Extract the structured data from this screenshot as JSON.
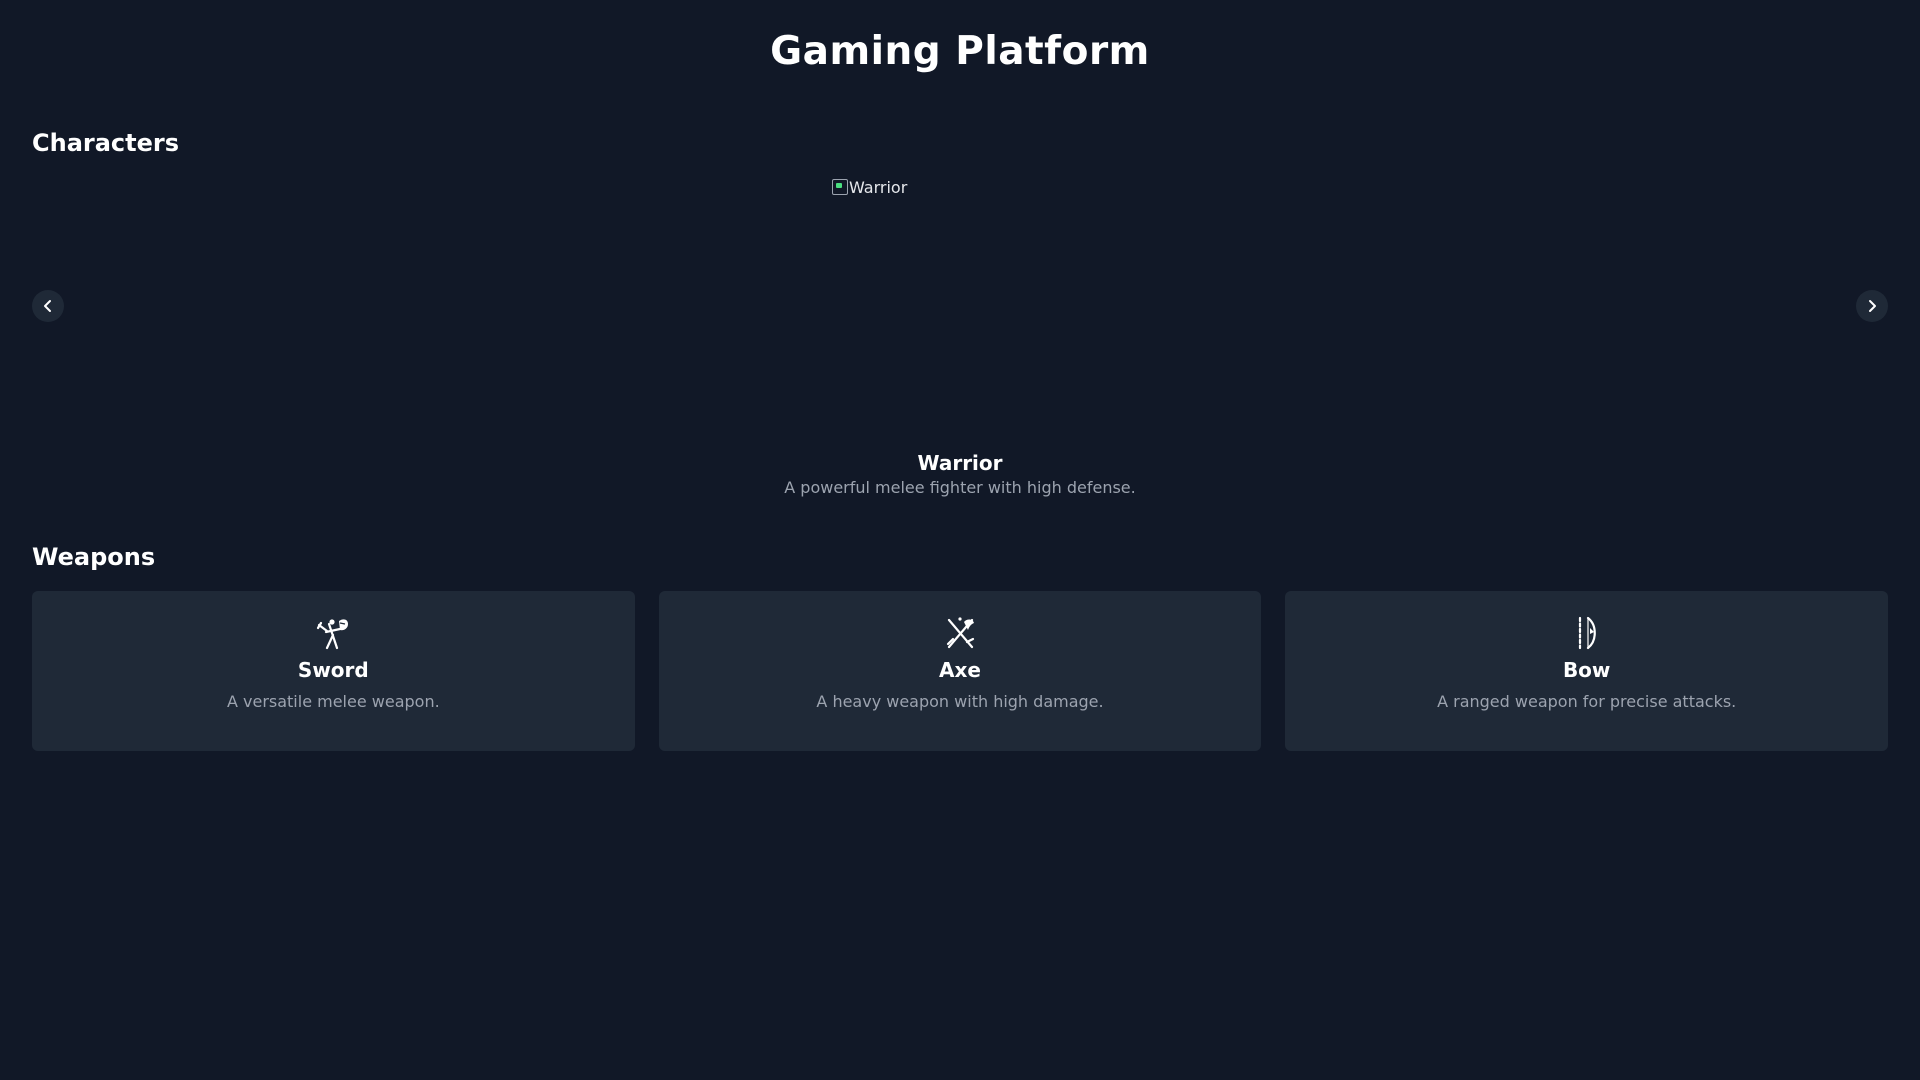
{
  "page": {
    "title": "Gaming Platform"
  },
  "characters": {
    "heading": "Characters",
    "current": {
      "image_alt": "Warrior",
      "name": "Warrior",
      "description": "A powerful melee fighter with high defense."
    },
    "prev_icon": "chevron-left-icon",
    "next_icon": "chevron-right-icon"
  },
  "weapons": {
    "heading": "Weapons",
    "items": [
      {
        "icon": "sword-icon",
        "name": "Sword",
        "description": "A versatile melee weapon."
      },
      {
        "icon": "axe-icon",
        "name": "Axe",
        "description": "A heavy weapon with high damage."
      },
      {
        "icon": "bow-icon",
        "name": "Bow",
        "description": "A ranged weapon for precise attacks."
      }
    ]
  },
  "colors": {
    "background": "#111827",
    "card": "#1f2937",
    "muted_text": "#9ca3af",
    "text": "#ffffff"
  }
}
